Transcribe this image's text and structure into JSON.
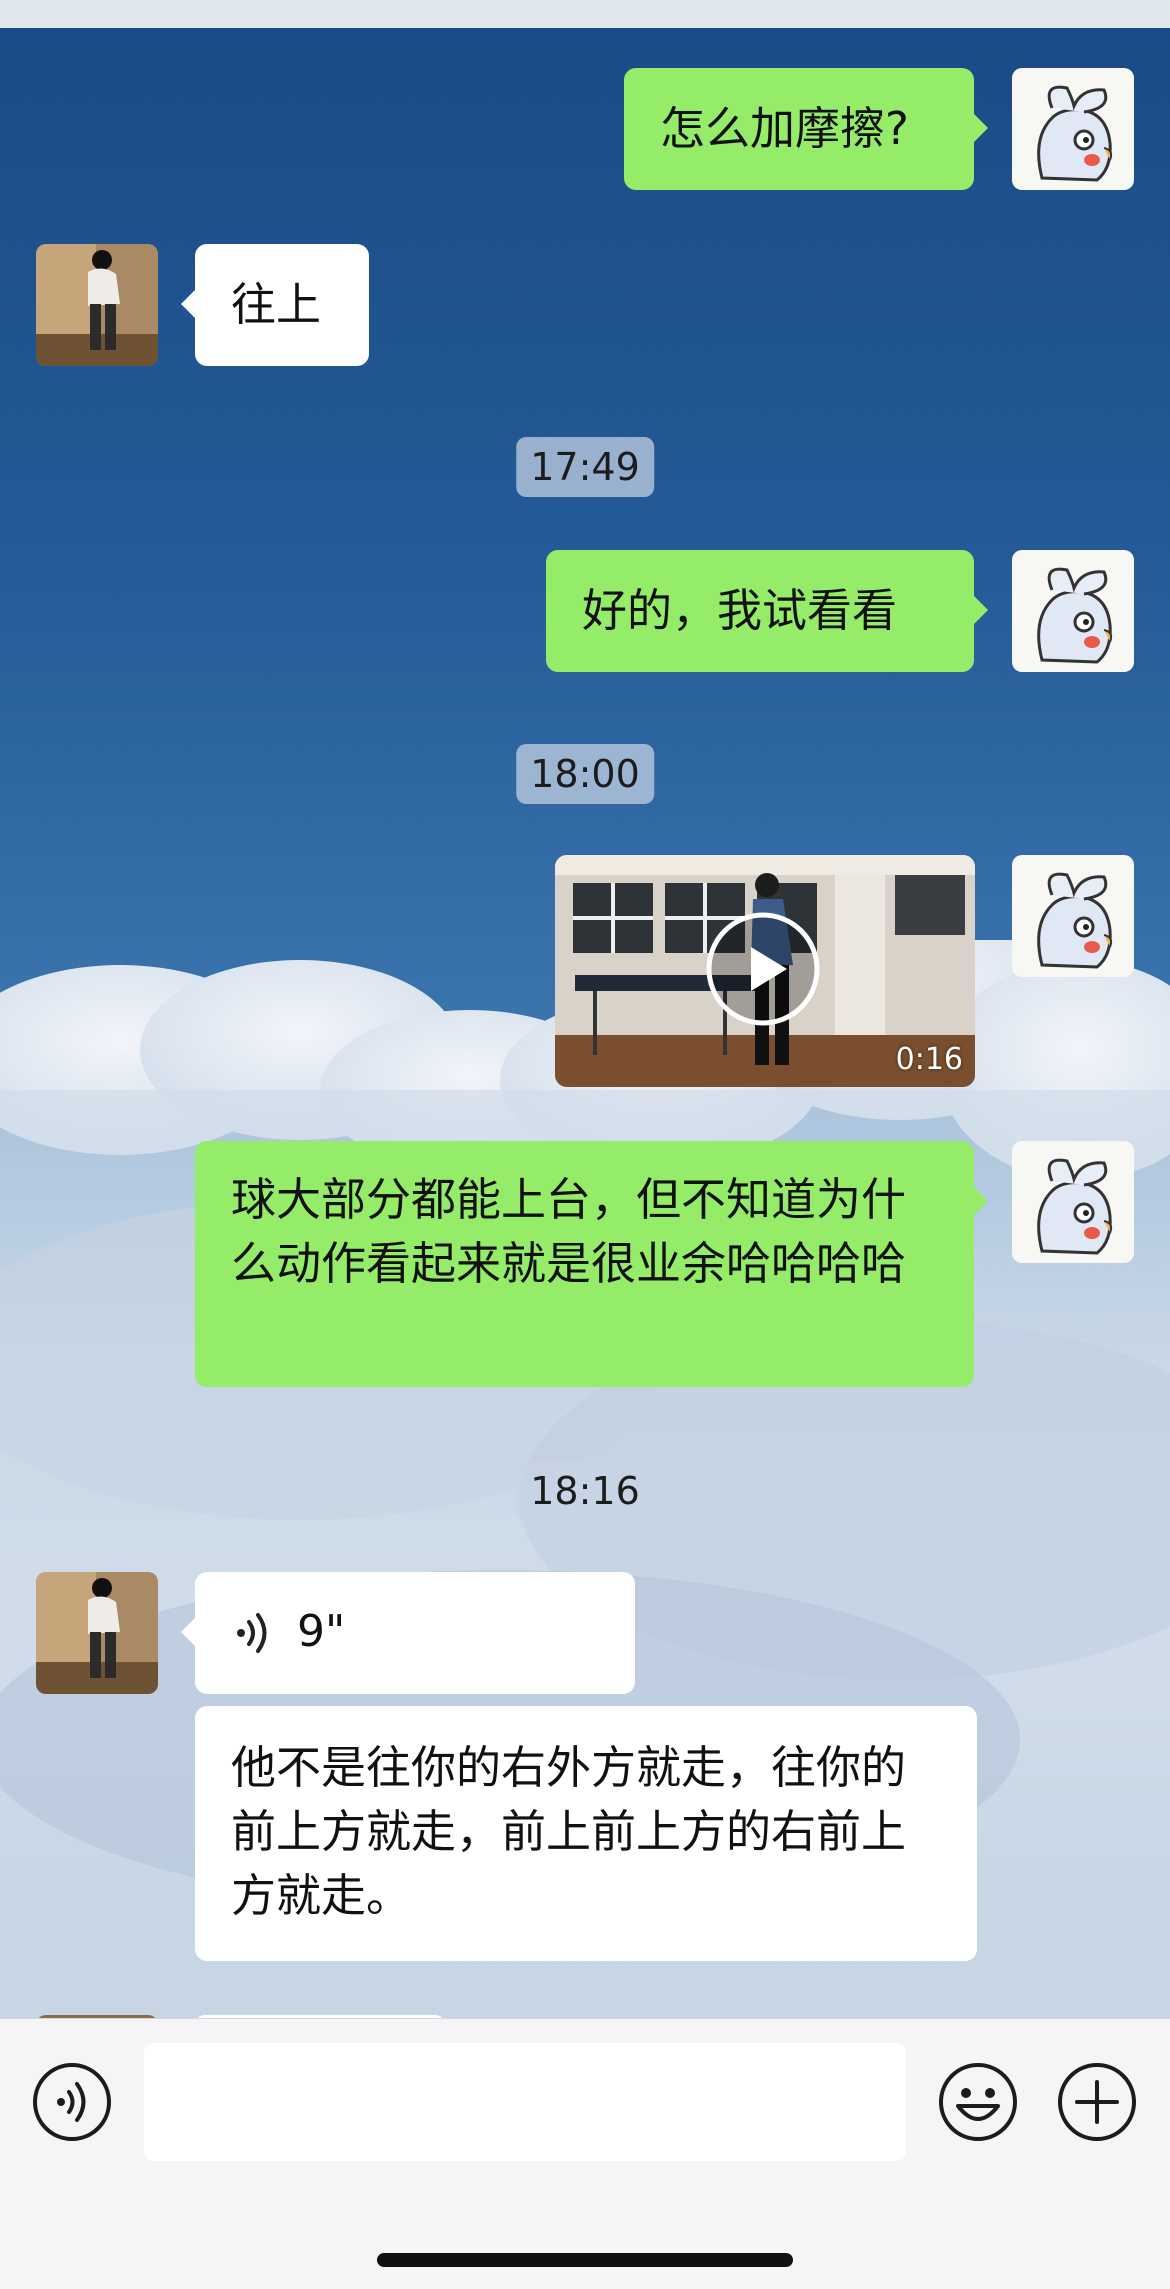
{
  "messages": {
    "m1": "怎么加摩擦?",
    "m2": "往上",
    "t1": "17:49",
    "m3": "好的，我试看看",
    "t2": "18:00",
    "video_duration": "0:16",
    "m4": "球大部分都能上台，但不知道为什么动作看起来就是很业余哈哈哈哈",
    "t3": "18:16",
    "voice_duration": "9\"",
    "m5": "他不是往你的右外方就走，往你的前上方就走，前上前上方的右前上方就走。"
  },
  "colors": {
    "my_bubble": "#95ec69",
    "other_bubble": "#ffffff"
  },
  "icons": {
    "voice_toggle": "voice-icon",
    "emoji": "emoji-icon",
    "more": "plus-icon",
    "play": "play-icon",
    "voice_wave": "sound-wave-icon"
  }
}
